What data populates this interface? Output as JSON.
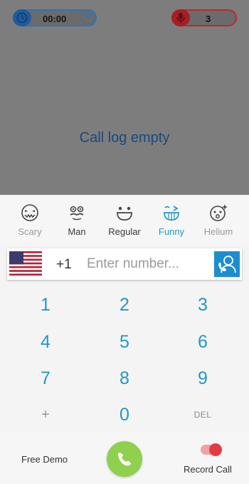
{
  "header": {
    "timer": "00:00",
    "timer_add_icon": "plus-circle-icon",
    "recordings_count": "3"
  },
  "call_log": {
    "empty_text": "Call log empty"
  },
  "effects": [
    {
      "label": "Scary",
      "icon": "scary-face-icon",
      "state": "dim"
    },
    {
      "label": "Man",
      "icon": "man-face-icon",
      "state": "normal"
    },
    {
      "label": "Regular",
      "icon": "regular-face-icon",
      "state": "normal"
    },
    {
      "label": "Funny",
      "icon": "funny-face-icon",
      "state": "selected"
    },
    {
      "label": "Helium",
      "icon": "helium-face-icon",
      "state": "dim"
    }
  ],
  "dialer": {
    "country_flag": "us-flag-icon",
    "country_code": "+1",
    "number_value": "",
    "number_placeholder": "Enter number...",
    "contacts_icon": "contacts-icon"
  },
  "keypad": {
    "keys": [
      "1",
      "2",
      "3",
      "4",
      "5",
      "6",
      "7",
      "8",
      "9",
      "+",
      "0",
      "DEL"
    ]
  },
  "bottom": {
    "free_demo": "Free Demo",
    "call_icon": "phone-icon",
    "record_call": "Record Call",
    "record_toggle_on": true
  },
  "colors": {
    "accent": "#1f98c8",
    "call_green": "#8fd14f",
    "record_red": "#e23b44",
    "overlay": "#7d7d7d"
  }
}
